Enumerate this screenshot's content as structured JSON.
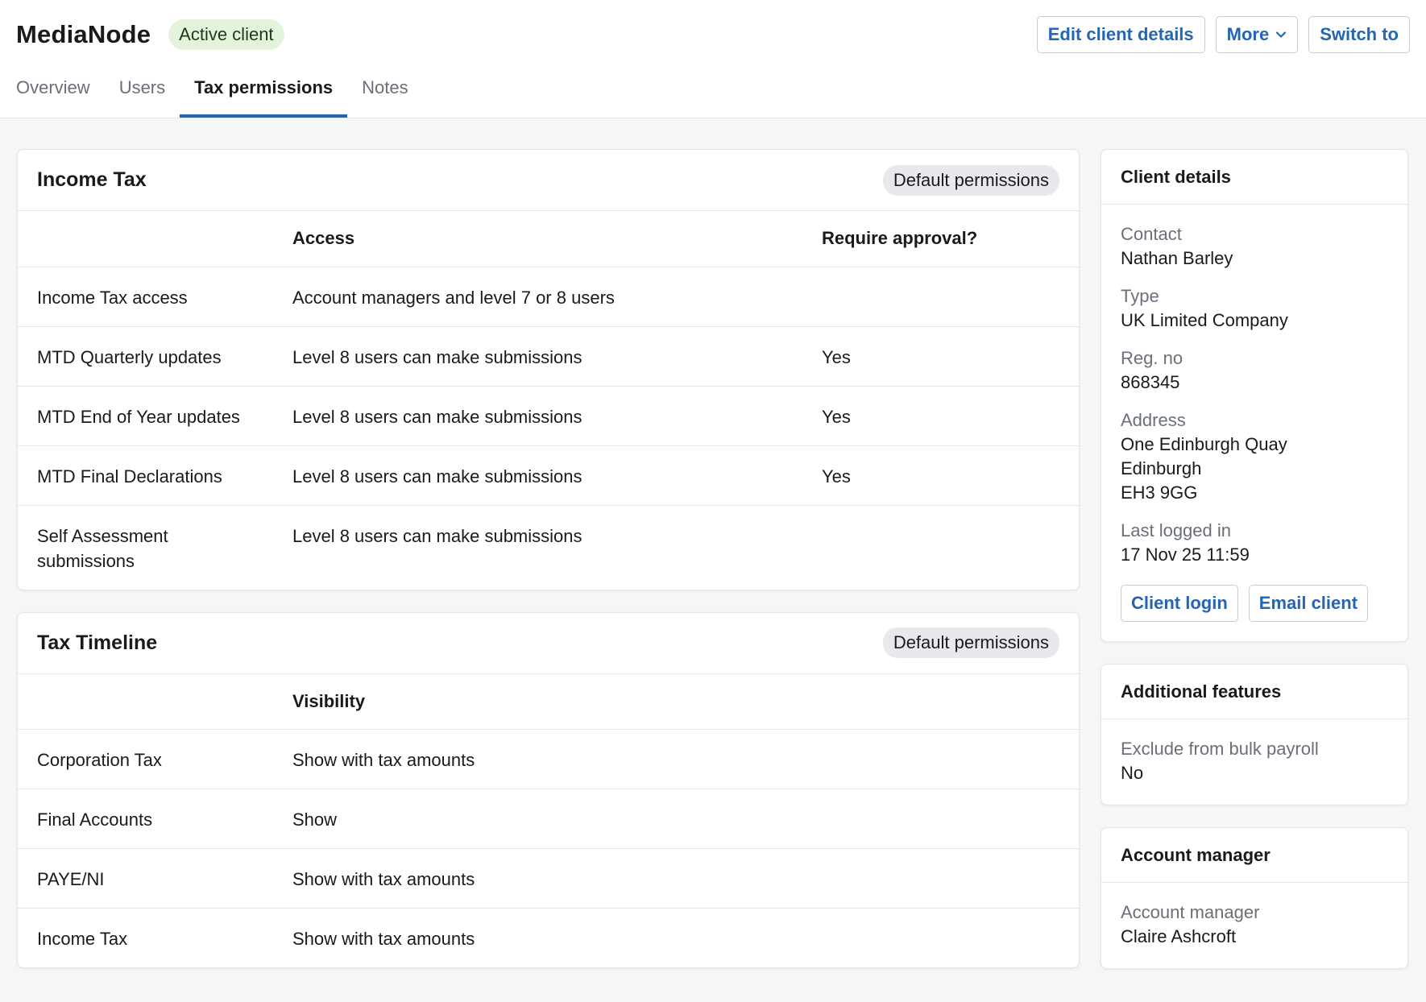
{
  "header": {
    "client_name": "MediaNode",
    "status": "Active client",
    "actions": {
      "edit": "Edit client details",
      "more": "More",
      "switch": "Switch to"
    }
  },
  "tabs": [
    {
      "label": "Overview",
      "active": false
    },
    {
      "label": "Users",
      "active": false
    },
    {
      "label": "Tax permissions",
      "active": true
    },
    {
      "label": "Notes",
      "active": false
    }
  ],
  "income_tax": {
    "title": "Income Tax",
    "badge": "Default permissions",
    "columns": [
      "",
      "Access",
      "Require approval?"
    ],
    "rows": [
      [
        "Income Tax access",
        "Account managers and level 7 or 8 users",
        ""
      ],
      [
        "MTD Quarterly updates",
        "Level 8 users can make submissions",
        "Yes"
      ],
      [
        "MTD End of Year updates",
        "Level 8 users can make submissions",
        "Yes"
      ],
      [
        "MTD Final Declarations",
        "Level 8 users can make submissions",
        "Yes"
      ],
      [
        "Self Assessment submissions",
        "Level 8 users can make submissions",
        ""
      ]
    ]
  },
  "tax_timeline": {
    "title": "Tax Timeline",
    "badge": "Default permissions",
    "columns": [
      "",
      "Visibility"
    ],
    "rows": [
      [
        "Corporation Tax",
        "Show with tax amounts"
      ],
      [
        "Final Accounts",
        "Show"
      ],
      [
        "PAYE/NI",
        "Show with tax amounts"
      ],
      [
        "Income Tax",
        "Show with tax amounts"
      ]
    ]
  },
  "client_details": {
    "title": "Client details",
    "contact_label": "Contact",
    "contact": "Nathan Barley",
    "type_label": "Type",
    "type": "UK Limited Company",
    "reg_label": "Reg. no",
    "reg": "868345",
    "address_label": "Address",
    "address_line1": "One Edinburgh Quay",
    "address_line2": "Edinburgh",
    "address_line3": "EH3 9GG",
    "last_login_label": "Last logged in",
    "last_login": "17 Nov 25 11:59",
    "login_button": "Client login",
    "email_button": "Email client"
  },
  "additional_features": {
    "title": "Additional features",
    "label": "Exclude from bulk payroll",
    "value": "No"
  },
  "account_manager": {
    "title": "Account manager",
    "label": "Account manager",
    "value": "Claire Ashcroft"
  },
  "colors": {
    "accent": "#2466b3",
    "status_bg": "#e3f3dc",
    "page_bg": "#f5f6f8"
  }
}
